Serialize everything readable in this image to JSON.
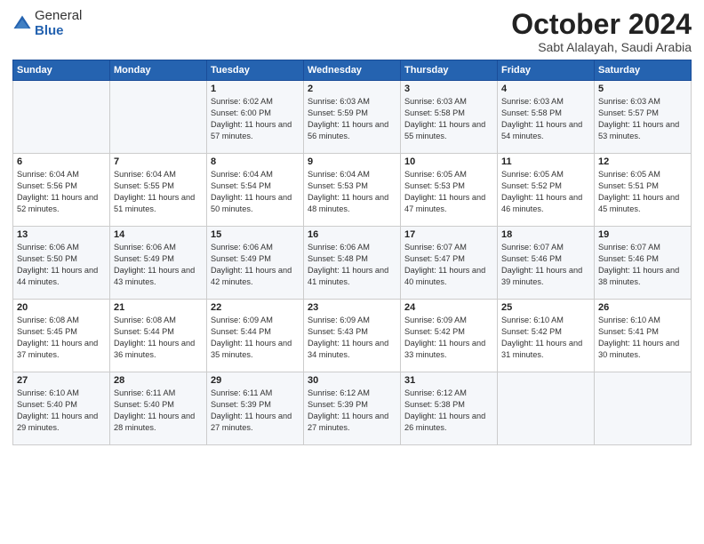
{
  "header": {
    "logo_general": "General",
    "logo_blue": "Blue",
    "month_title": "October 2024",
    "subtitle": "Sabt Alalayah, Saudi Arabia"
  },
  "weekdays": [
    "Sunday",
    "Monday",
    "Tuesday",
    "Wednesday",
    "Thursday",
    "Friday",
    "Saturday"
  ],
  "weeks": [
    [
      {
        "day": "",
        "sunrise": "",
        "sunset": "",
        "daylight": ""
      },
      {
        "day": "",
        "sunrise": "",
        "sunset": "",
        "daylight": ""
      },
      {
        "day": "1",
        "sunrise": "Sunrise: 6:02 AM",
        "sunset": "Sunset: 6:00 PM",
        "daylight": "Daylight: 11 hours and 57 minutes."
      },
      {
        "day": "2",
        "sunrise": "Sunrise: 6:03 AM",
        "sunset": "Sunset: 5:59 PM",
        "daylight": "Daylight: 11 hours and 56 minutes."
      },
      {
        "day": "3",
        "sunrise": "Sunrise: 6:03 AM",
        "sunset": "Sunset: 5:58 PM",
        "daylight": "Daylight: 11 hours and 55 minutes."
      },
      {
        "day": "4",
        "sunrise": "Sunrise: 6:03 AM",
        "sunset": "Sunset: 5:58 PM",
        "daylight": "Daylight: 11 hours and 54 minutes."
      },
      {
        "day": "5",
        "sunrise": "Sunrise: 6:03 AM",
        "sunset": "Sunset: 5:57 PM",
        "daylight": "Daylight: 11 hours and 53 minutes."
      }
    ],
    [
      {
        "day": "6",
        "sunrise": "Sunrise: 6:04 AM",
        "sunset": "Sunset: 5:56 PM",
        "daylight": "Daylight: 11 hours and 52 minutes."
      },
      {
        "day": "7",
        "sunrise": "Sunrise: 6:04 AM",
        "sunset": "Sunset: 5:55 PM",
        "daylight": "Daylight: 11 hours and 51 minutes."
      },
      {
        "day": "8",
        "sunrise": "Sunrise: 6:04 AM",
        "sunset": "Sunset: 5:54 PM",
        "daylight": "Daylight: 11 hours and 50 minutes."
      },
      {
        "day": "9",
        "sunrise": "Sunrise: 6:04 AM",
        "sunset": "Sunset: 5:53 PM",
        "daylight": "Daylight: 11 hours and 48 minutes."
      },
      {
        "day": "10",
        "sunrise": "Sunrise: 6:05 AM",
        "sunset": "Sunset: 5:53 PM",
        "daylight": "Daylight: 11 hours and 47 minutes."
      },
      {
        "day": "11",
        "sunrise": "Sunrise: 6:05 AM",
        "sunset": "Sunset: 5:52 PM",
        "daylight": "Daylight: 11 hours and 46 minutes."
      },
      {
        "day": "12",
        "sunrise": "Sunrise: 6:05 AM",
        "sunset": "Sunset: 5:51 PM",
        "daylight": "Daylight: 11 hours and 45 minutes."
      }
    ],
    [
      {
        "day": "13",
        "sunrise": "Sunrise: 6:06 AM",
        "sunset": "Sunset: 5:50 PM",
        "daylight": "Daylight: 11 hours and 44 minutes."
      },
      {
        "day": "14",
        "sunrise": "Sunrise: 6:06 AM",
        "sunset": "Sunset: 5:49 PM",
        "daylight": "Daylight: 11 hours and 43 minutes."
      },
      {
        "day": "15",
        "sunrise": "Sunrise: 6:06 AM",
        "sunset": "Sunset: 5:49 PM",
        "daylight": "Daylight: 11 hours and 42 minutes."
      },
      {
        "day": "16",
        "sunrise": "Sunrise: 6:06 AM",
        "sunset": "Sunset: 5:48 PM",
        "daylight": "Daylight: 11 hours and 41 minutes."
      },
      {
        "day": "17",
        "sunrise": "Sunrise: 6:07 AM",
        "sunset": "Sunset: 5:47 PM",
        "daylight": "Daylight: 11 hours and 40 minutes."
      },
      {
        "day": "18",
        "sunrise": "Sunrise: 6:07 AM",
        "sunset": "Sunset: 5:46 PM",
        "daylight": "Daylight: 11 hours and 39 minutes."
      },
      {
        "day": "19",
        "sunrise": "Sunrise: 6:07 AM",
        "sunset": "Sunset: 5:46 PM",
        "daylight": "Daylight: 11 hours and 38 minutes."
      }
    ],
    [
      {
        "day": "20",
        "sunrise": "Sunrise: 6:08 AM",
        "sunset": "Sunset: 5:45 PM",
        "daylight": "Daylight: 11 hours and 37 minutes."
      },
      {
        "day": "21",
        "sunrise": "Sunrise: 6:08 AM",
        "sunset": "Sunset: 5:44 PM",
        "daylight": "Daylight: 11 hours and 36 minutes."
      },
      {
        "day": "22",
        "sunrise": "Sunrise: 6:09 AM",
        "sunset": "Sunset: 5:44 PM",
        "daylight": "Daylight: 11 hours and 35 minutes."
      },
      {
        "day": "23",
        "sunrise": "Sunrise: 6:09 AM",
        "sunset": "Sunset: 5:43 PM",
        "daylight": "Daylight: 11 hours and 34 minutes."
      },
      {
        "day": "24",
        "sunrise": "Sunrise: 6:09 AM",
        "sunset": "Sunset: 5:42 PM",
        "daylight": "Daylight: 11 hours and 33 minutes."
      },
      {
        "day": "25",
        "sunrise": "Sunrise: 6:10 AM",
        "sunset": "Sunset: 5:42 PM",
        "daylight": "Daylight: 11 hours and 31 minutes."
      },
      {
        "day": "26",
        "sunrise": "Sunrise: 6:10 AM",
        "sunset": "Sunset: 5:41 PM",
        "daylight": "Daylight: 11 hours and 30 minutes."
      }
    ],
    [
      {
        "day": "27",
        "sunrise": "Sunrise: 6:10 AM",
        "sunset": "Sunset: 5:40 PM",
        "daylight": "Daylight: 11 hours and 29 minutes."
      },
      {
        "day": "28",
        "sunrise": "Sunrise: 6:11 AM",
        "sunset": "Sunset: 5:40 PM",
        "daylight": "Daylight: 11 hours and 28 minutes."
      },
      {
        "day": "29",
        "sunrise": "Sunrise: 6:11 AM",
        "sunset": "Sunset: 5:39 PM",
        "daylight": "Daylight: 11 hours and 27 minutes."
      },
      {
        "day": "30",
        "sunrise": "Sunrise: 6:12 AM",
        "sunset": "Sunset: 5:39 PM",
        "daylight": "Daylight: 11 hours and 27 minutes."
      },
      {
        "day": "31",
        "sunrise": "Sunrise: 6:12 AM",
        "sunset": "Sunset: 5:38 PM",
        "daylight": "Daylight: 11 hours and 26 minutes."
      },
      {
        "day": "",
        "sunrise": "",
        "sunset": "",
        "daylight": ""
      },
      {
        "day": "",
        "sunrise": "",
        "sunset": "",
        "daylight": ""
      }
    ]
  ]
}
